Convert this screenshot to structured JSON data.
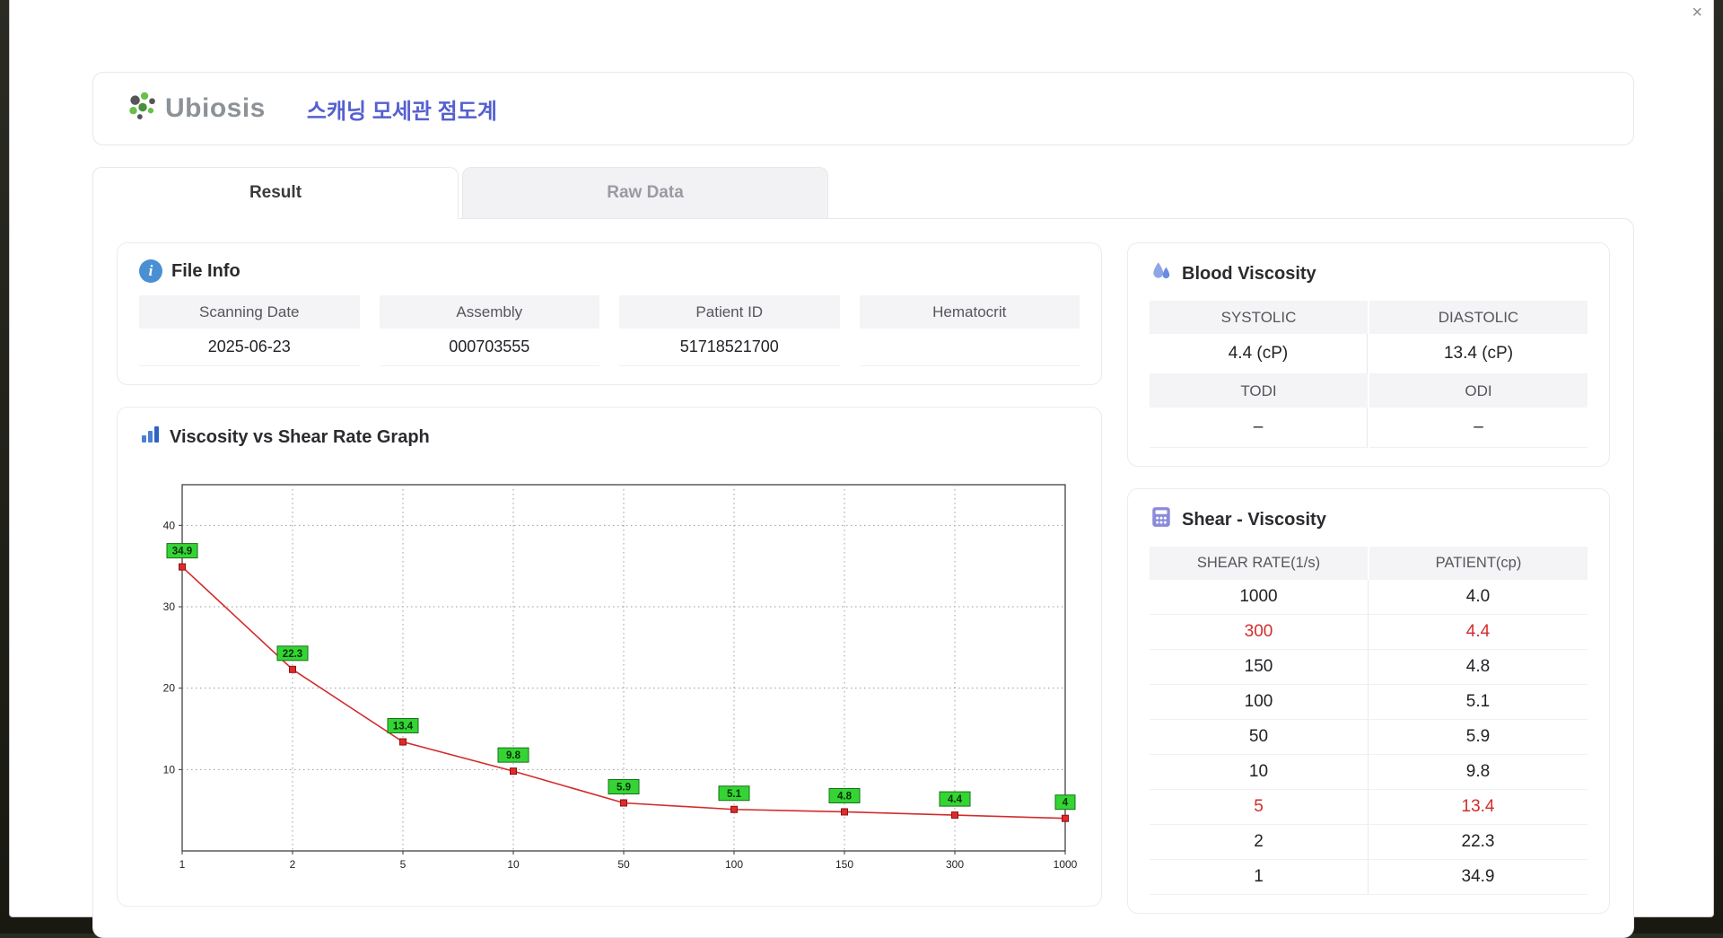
{
  "window": {
    "close_label": "×"
  },
  "header": {
    "logo_text": "Ubiosis",
    "app_title": "스캐닝 모세관 점도계"
  },
  "tabs": {
    "result": "Result",
    "raw_data": "Raw Data"
  },
  "file_info": {
    "title": "File Info",
    "fields": [
      {
        "label": "Scanning Date",
        "value": "2025-06-23"
      },
      {
        "label": "Assembly",
        "value": "000703555"
      },
      {
        "label": "Patient ID",
        "value": "51718521700"
      },
      {
        "label": "Hematocrit",
        "value": ""
      }
    ]
  },
  "blood_viscosity": {
    "title": "Blood Viscosity",
    "pairs": [
      {
        "labels": [
          "SYSTOLIC",
          "DIASTOLIC"
        ],
        "values": [
          "4.4 (cP)",
          "13.4 (cP)"
        ]
      },
      {
        "labels": [
          "TODI",
          "ODI"
        ],
        "values": [
          "–",
          "–"
        ]
      }
    ]
  },
  "graph": {
    "title": "Viscosity vs Shear Rate Graph"
  },
  "shear_viscosity": {
    "title": "Shear - Viscosity",
    "columns": [
      "SHEAR RATE(1/s)",
      "PATIENT(cp)"
    ],
    "rows": [
      {
        "shear": "1000",
        "patient": "4.0",
        "highlight": false
      },
      {
        "shear": "300",
        "patient": "4.4",
        "highlight": true
      },
      {
        "shear": "150",
        "patient": "4.8",
        "highlight": false
      },
      {
        "shear": "100",
        "patient": "5.1",
        "highlight": false
      },
      {
        "shear": "50",
        "patient": "5.9",
        "highlight": false
      },
      {
        "shear": "10",
        "patient": "9.8",
        "highlight": false
      },
      {
        "shear": "5",
        "patient": "13.4",
        "highlight": true
      },
      {
        "shear": "2",
        "patient": "22.3",
        "highlight": false
      },
      {
        "shear": "1",
        "patient": "34.9",
        "highlight": false
      }
    ]
  },
  "chart_data": {
    "type": "line",
    "title": "Viscosity vs Shear Rate Graph",
    "x_labels": [
      "1",
      "2",
      "5",
      "10",
      "50",
      "100",
      "150",
      "300",
      "1000"
    ],
    "values": [
      34.9,
      22.3,
      13.4,
      9.8,
      5.9,
      5.1,
      4.8,
      4.4,
      4.0
    ],
    "point_labels": [
      "34.9",
      "22.3",
      "13.4",
      "9.8",
      "5.9",
      "5.1",
      "4.8",
      "4.4",
      "4"
    ],
    "y_ticks": [
      10,
      20,
      30,
      40
    ],
    "ylim": [
      0,
      45
    ],
    "x_scale": "log-categorical",
    "grid": "dotted",
    "legend": "none",
    "line_color": "#d22c2c",
    "marker_color": "#e02b2b",
    "label_bg": "#35d435",
    "label_border": "#157015"
  }
}
